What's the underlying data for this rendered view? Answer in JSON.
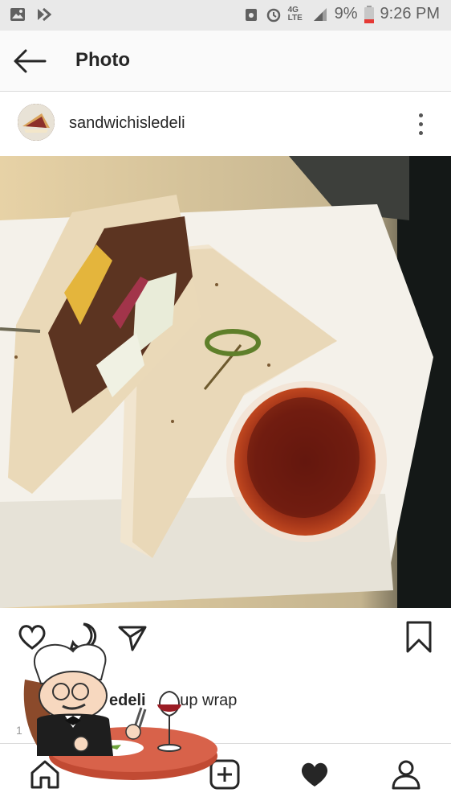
{
  "status_bar": {
    "battery": "9%",
    "time": "9:26 PM",
    "network": "4G LTE",
    "icons": [
      "image-icon",
      "download-icon",
      "vpn-icon",
      "alarm-icon",
      "lte-icon",
      "signal-icon",
      "battery-icon"
    ]
  },
  "app_bar": {
    "title": "Photo",
    "back_icon": "arrow-left-icon"
  },
  "post": {
    "username": "sandwichisledeli",
    "more_icon": "more-vertical-icon",
    "photo_description_icon": "photo",
    "caption_user": "edeli",
    "caption_text": "e up wrap",
    "time_fragment": "1"
  },
  "actions": {
    "icons": [
      "heart-icon",
      "comment-icon",
      "share-icon",
      "bookmark-icon"
    ]
  },
  "bottom_nav": {
    "icons": [
      "home-icon",
      "add-post-icon",
      "activity-heart-icon",
      "profile-icon"
    ]
  },
  "colors": {
    "status_bar_bg": "#e9e9e9",
    "text_primary": "#262626",
    "divider": "#dbdbdb"
  }
}
